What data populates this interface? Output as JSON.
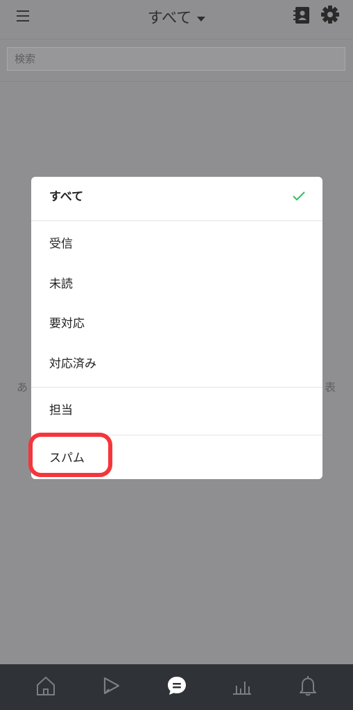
{
  "header": {
    "title": "すべて"
  },
  "search": {
    "placeholder": "検索"
  },
  "background": {
    "left_text": "あ",
    "right_text": "表"
  },
  "dropdown": {
    "items": [
      {
        "label": "すべて",
        "selected": true
      },
      {
        "label": "受信",
        "selected": false
      },
      {
        "label": "未読",
        "selected": false
      },
      {
        "label": "要対応",
        "selected": false
      },
      {
        "label": "対応済み",
        "selected": false
      },
      {
        "label": "担当",
        "selected": false
      },
      {
        "label": "スパム",
        "selected": false,
        "highlighted": true
      }
    ]
  },
  "bottom_nav": {
    "items": [
      {
        "icon": "home-icon",
        "active": false
      },
      {
        "icon": "play-icon",
        "active": false
      },
      {
        "icon": "chat-icon",
        "active": true
      },
      {
        "icon": "chart-icon",
        "active": false
      },
      {
        "icon": "bell-icon",
        "active": false
      }
    ]
  },
  "colors": {
    "overlay_bg": "#8f8f92",
    "check_green": "#2fbf5e",
    "highlight_red": "#f5353b",
    "nav_bg": "#2f3236"
  }
}
